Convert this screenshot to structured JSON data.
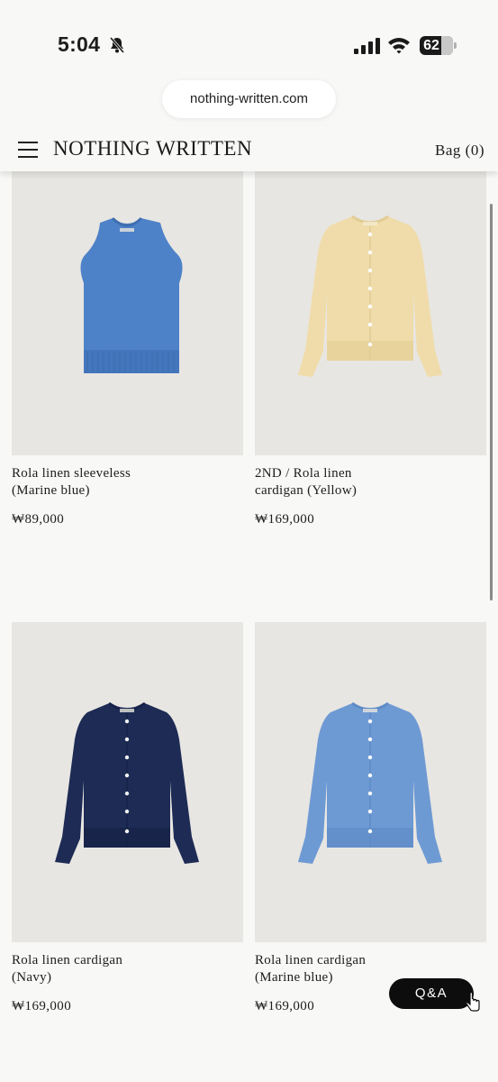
{
  "status_bar": {
    "time": "5:04",
    "battery": "62"
  },
  "browser": {
    "url": "nothing-written.com"
  },
  "header": {
    "logo": "NOTHING WRITTEN",
    "bag_label": "Bag (0)"
  },
  "products": [
    {
      "name_line1": "Rola linen sleeveless",
      "name_line2": "(Marine blue)",
      "price": "₩89,000",
      "garment": "vest",
      "color": "#4e82c8",
      "color_dark": "#3f6fb0"
    },
    {
      "name_line1": "2ND / Rola linen",
      "name_line2": "cardigan (Yellow)",
      "price": "₩169,000",
      "garment": "cardigan",
      "color": "#efdcaa",
      "color_dark": "#e2cc96"
    },
    {
      "name_line1": "Rola linen cardigan",
      "name_line2": "(Navy)",
      "price": "₩169,000",
      "garment": "cardigan",
      "color": "#1d2b55",
      "color_dark": "#16224a"
    },
    {
      "name_line1": "Rola linen cardigan",
      "name_line2": "(Marine blue)",
      "price": "₩169,000",
      "garment": "cardigan",
      "color": "#6e9ad4",
      "color_dark": "#5f8bc6"
    }
  ],
  "qa_button": {
    "label": "Q&A"
  },
  "icons": {
    "bell": "bell-slash-icon",
    "signal": "cellular-signal-icon",
    "wifi": "wifi-icon",
    "battery": "battery-icon",
    "menu": "hamburger-menu-icon",
    "cursor": "pointer-cursor-icon"
  }
}
